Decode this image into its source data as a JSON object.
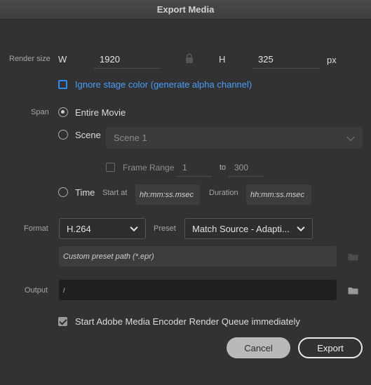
{
  "window": {
    "title": "Export Media"
  },
  "render_size": {
    "label": "Render size",
    "w_label": "W",
    "width": "1920",
    "h_label": "H",
    "height": "325",
    "unit": "px",
    "ignore_stage_color_label": "Ignore stage color (generate alpha channel)"
  },
  "span": {
    "label": "Span",
    "entire_movie_label": "Entire Movie",
    "scene_label": "Scene",
    "scene_value": "Scene 1",
    "frame_range_label": "Frame Range",
    "frame_from": "1",
    "to_label": "to",
    "frame_to": "300",
    "time_label": "Time",
    "start_at_label": "Start at",
    "start_at_placeholder": "hh:mm:ss.msec",
    "duration_label": "Duration",
    "duration_placeholder": "hh:mm:ss.msec"
  },
  "format": {
    "label": "Format",
    "value": "H.264",
    "preset_label": "Preset",
    "preset_value": "Match Source - Adapti...",
    "custom_preset_placeholder": "Custom preset path (*.epr)"
  },
  "output": {
    "label": "Output",
    "value": "/"
  },
  "start_queue_label": "Start Adobe Media Encoder Render Queue immediately",
  "buttons": {
    "cancel": "Cancel",
    "export": "Export"
  },
  "colors": {
    "accent": "#2c8cf0",
    "background": "#323232"
  }
}
